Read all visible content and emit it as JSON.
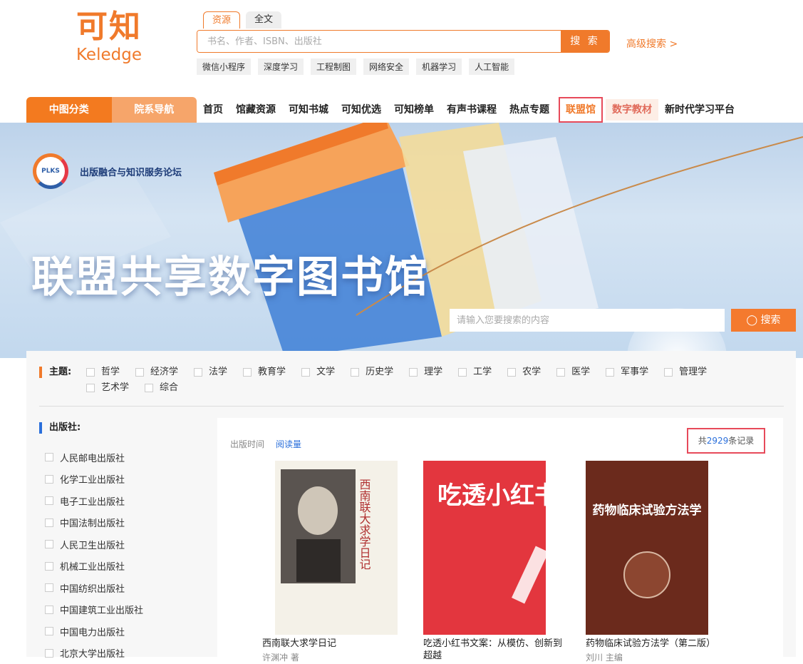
{
  "logo": {
    "cn": "可知",
    "en": "Keledge"
  },
  "search": {
    "tabs": [
      "资源",
      "全文"
    ],
    "placeholder": "书名、作者、ISBN、出版社",
    "button": "搜 索",
    "advanced": "高级搜索 >",
    "hot_tags": [
      "微信小程序",
      "深度学习",
      "工程制图",
      "网络安全",
      "机器学习",
      "人工智能"
    ]
  },
  "nav": {
    "side": [
      "中图分类",
      "院系导航"
    ],
    "items": [
      "首页",
      "馆藏资源",
      "可知书城",
      "可知优选",
      "可知榜单",
      "有声书课程",
      "热点专题",
      "联盟馆",
      "数字教材",
      "新时代学习平台"
    ]
  },
  "banner": {
    "logo_text": "PLKS",
    "forum": "出版融合与知识服务论坛",
    "title": "联盟共享数字图书馆",
    "search_placeholder": "请输入您要搜索的内容",
    "search_button": "搜索"
  },
  "filters": {
    "subject_label": "主题:",
    "subjects": [
      "哲学",
      "经济学",
      "法学",
      "教育学",
      "文学",
      "历史学",
      "理学",
      "工学",
      "农学",
      "医学",
      "军事学",
      "管理学",
      "艺术学",
      "综合"
    ],
    "publisher_label": "出版社:",
    "publishers": [
      "人民邮电出版社",
      "化学工业出版社",
      "电子工业出版社",
      "中国法制出版社",
      "人民卫生出版社",
      "机械工业出版社",
      "中国纺织出版社",
      "中国建筑工业出版社",
      "中国电力出版社",
      "北京大学出版社"
    ]
  },
  "results": {
    "sort_time": "出版时间",
    "sort_read": "阅读量",
    "total_prefix": "共",
    "total_count": "2929",
    "total_suffix": "条记录",
    "books": [
      {
        "title": "西南联大求学日记",
        "author": "许渊冲 著",
        "cover_text": "西南联大求学日记"
      },
      {
        "title": "吃透小红书文案：从模仿、创新到超越",
        "author": "",
        "cover_text": "吃透小红书文案"
      },
      {
        "title": "药物临床试验方法学（第二版）",
        "author": "刘川 主编",
        "cover_text": "药物临床试验方法学"
      }
    ]
  },
  "colors": {
    "accent": "#f07a2b",
    "highlight_border": "#e74a5a",
    "link": "#2a6fdb"
  }
}
